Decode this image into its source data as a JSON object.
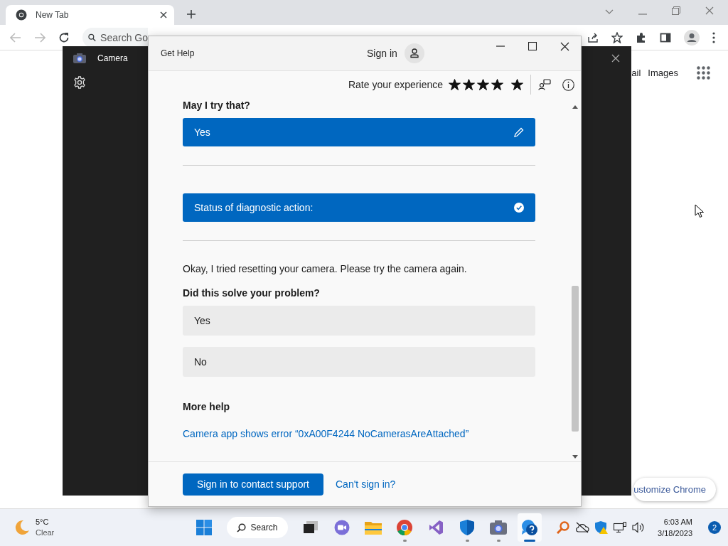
{
  "browser": {
    "tab": {
      "title": "New Tab",
      "selected": true
    },
    "address_bar": {
      "placeholder": "Search Go"
    },
    "header_links": [
      "ail",
      "Images"
    ],
    "customize_button": "ustomize Chrome"
  },
  "camera_window": {
    "title": "Camera"
  },
  "help_window": {
    "title": "Get Help",
    "sign_in": "Sign in",
    "rating": {
      "label": "Rate your experience",
      "stars": 5
    },
    "conversation": [
      {
        "kind": "heading",
        "text": "May I try that?"
      },
      {
        "kind": "answer",
        "text": "Yes"
      },
      {
        "kind": "status",
        "text": "Status of diagnostic action:"
      },
      {
        "kind": "text",
        "text": "Okay, I tried resetting your camera. Please try the camera again."
      },
      {
        "kind": "heading",
        "text": "Did this solve your problem?"
      },
      {
        "kind": "option",
        "text": "Yes"
      },
      {
        "kind": "option",
        "text": "No"
      },
      {
        "kind": "heading",
        "text": "More help"
      },
      {
        "kind": "link",
        "text": "Camera app shows error “0xA00F4244 NoCamerasAreAttached”"
      }
    ],
    "footer": {
      "button": "Sign in to contact support",
      "link": "Can't sign in?"
    }
  },
  "taskbar": {
    "weather": {
      "temperature": "5°C",
      "condition": "Clear"
    },
    "search": "Search",
    "apps": [
      {
        "kind": "start",
        "running": false,
        "active": false
      },
      {
        "kind": "search",
        "running": false,
        "active": false
      },
      {
        "kind": "taskview",
        "running": false,
        "active": false
      },
      {
        "kind": "chat",
        "running": false,
        "active": false
      },
      {
        "kind": "files",
        "running": false,
        "active": false
      },
      {
        "kind": "chrome",
        "running": true,
        "active": false
      },
      {
        "kind": "studio",
        "running": false,
        "active": false
      },
      {
        "kind": "shield",
        "running": true,
        "active": false
      },
      {
        "kind": "camera",
        "running": true,
        "active": false
      },
      {
        "kind": "help",
        "running": true,
        "active": true
      }
    ],
    "time": "6:03 AM",
    "date": "3/18/2023",
    "notifications": "2"
  }
}
